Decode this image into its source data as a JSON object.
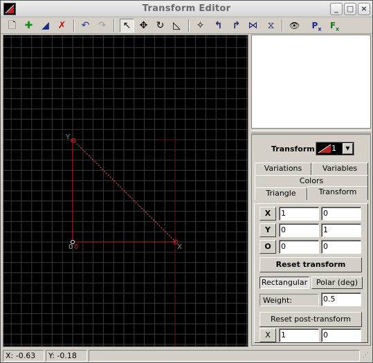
{
  "window": {
    "title": "Transform Editor",
    "btn_min": "_",
    "btn_max": "□",
    "btn_close": "×"
  },
  "toolbar": {
    "icons": [
      "new-icon",
      "add-icon",
      "duplicate-icon",
      "delete-icon",
      "undo-icon",
      "redo-icon",
      "select-icon",
      "move-icon",
      "rotate-icon",
      "scale-icon",
      "flip-icon",
      "rotate-left-icon",
      "rotate-right-icon",
      "flip-horizontal-icon",
      "flip-vertical-icon",
      "preview-icon",
      "post-transform-icon",
      "final-transform-icon"
    ],
    "glyphs": {
      "new": "🗋",
      "add": "✚",
      "duplicate": "◢",
      "delete": "✗",
      "undo": "↶",
      "redo": "↷",
      "select": "↖",
      "move": "✥",
      "rotate": "↻",
      "scale": "◺",
      "flip": "✧",
      "rot_left": "↰",
      "rot_right": "↱",
      "flip_h": "⋈",
      "flip_v": "⧖",
      "preview": "👁",
      "post": "P",
      "final": "F",
      "post_sub": "x",
      "final_sub": "x"
    }
  },
  "canvas": {
    "label_y": "Y",
    "label_o_white": "0",
    "label_o_red": "0",
    "label_x": "X",
    "colors": {
      "background": "#000000",
      "grid": "#3a3a3a",
      "triangle": "#cc2222",
      "dashed": "#ff5050"
    }
  },
  "panel": {
    "transform_label": "Transform",
    "transform_value": "1",
    "tabs_row1": [
      "Variations",
      "Variables"
    ],
    "tabs_row2": [
      "Colors"
    ],
    "tabs_row3": [
      "Triangle",
      "Transform"
    ],
    "active_tab": "Transform",
    "rows": [
      {
        "label": "X",
        "a": "1",
        "b": "0"
      },
      {
        "label": "Y",
        "a": "0",
        "b": "1"
      },
      {
        "label": "O",
        "a": "0",
        "b": "0"
      }
    ],
    "reset_transform": "Reset transform",
    "coord_modes": [
      "Rectangular",
      "Polar (deg)"
    ],
    "active_mode": "Rectangular",
    "weight_label": "Weight:",
    "weight_value": "0.5",
    "reset_post": "Reset post-transform",
    "post_row": {
      "label": "X",
      "a": "1",
      "b": "0"
    }
  },
  "status": {
    "x": "X: -0.63",
    "y": "Y: -0.18"
  }
}
